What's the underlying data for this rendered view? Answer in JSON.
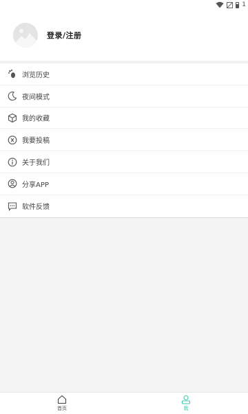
{
  "status_bar": {
    "battery_text": "1"
  },
  "profile": {
    "login_label": "登录/注册"
  },
  "menu": {
    "items": [
      {
        "label": "浏览历史",
        "icon": "footprint-icon"
      },
      {
        "label": "夜间模式",
        "icon": "moon-icon"
      },
      {
        "label": "我的收藏",
        "icon": "box-icon"
      },
      {
        "label": "我要投稿",
        "icon": "contribute-icon"
      },
      {
        "label": "关于我们",
        "icon": "info-icon"
      },
      {
        "label": "分享APP",
        "icon": "user-circle-icon"
      },
      {
        "label": "软件反馈",
        "icon": "feedback-icon"
      }
    ]
  },
  "tabs": [
    {
      "label": "首页",
      "icon": "home-icon",
      "active": false
    },
    {
      "label": "我",
      "icon": "person-icon",
      "active": true
    }
  ],
  "colors": {
    "accent": "#3cc8b0",
    "background": "#f4f4f4"
  }
}
